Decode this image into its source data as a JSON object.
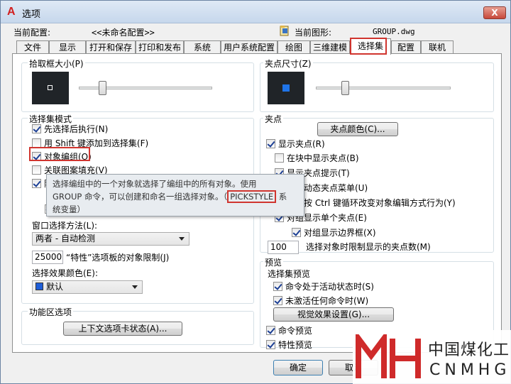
{
  "window": {
    "title": "选项",
    "app_icon": "A",
    "close_label": "X"
  },
  "header": {
    "profile_label": "当前配置:",
    "profile_value": "<<未命名配置>>",
    "drawing_label": "当前图形:",
    "drawing_value": "GROUP.dwg"
  },
  "tabs": [
    "文件",
    "显示",
    "打开和保存",
    "打印和发布",
    "系统",
    "用户系统配置",
    "绘图",
    "三维建模",
    "选择集",
    "配置",
    "联机"
  ],
  "active_tab": "选择集",
  "left": {
    "pickbox": {
      "title": "拾取框大小(P)"
    },
    "selection_modes": {
      "title": "选择集模式",
      "items": [
        {
          "label": "先选择后执行(N)",
          "checked": true
        },
        {
          "label": "用 Shift 键添加到选择集(F)",
          "checked": false
        },
        {
          "label": "对象编组(O)",
          "checked": true
        },
        {
          "label": "关联图案填充(V)",
          "checked": false
        },
        {
          "label": "隐",
          "checked": true
        },
        {
          "label": "",
          "checked": true
        }
      ]
    },
    "window_method": {
      "label": "窗口选择方法(L):",
      "value": "两者 - 自动检测"
    },
    "limit": {
      "value": "25000",
      "label": "“特性”选项板的对象限制(J)"
    },
    "effect_color": {
      "label": "选择效果颜色(E):",
      "value": "默认"
    },
    "ribbon": {
      "title": "功能区选项",
      "button": "上下文选项卡状态(A)..."
    }
  },
  "right": {
    "gripsize": {
      "title": "夹点尺寸(Z)"
    },
    "grips": {
      "title": "夹点",
      "color_button": "夹点颜色(C)...",
      "items": [
        {
          "label": "显示夹点(R)",
          "checked": true
        },
        {
          "label": "在块中显示夹点(B)",
          "checked": false
        },
        {
          "label": "显示夹点提示(T)",
          "checked": true
        },
        {
          "label": "显示动态夹点菜单(U)",
          "checked": true
        },
        {
          "label": "允许按 Ctrl 键循环改变对象编辑方式行为(Y)",
          "checked": true
        },
        {
          "label": "对组显示单个夹点(E)",
          "checked": true
        },
        {
          "label": "对组显示边界框(X)",
          "checked": true
        }
      ],
      "limit_value": "100",
      "limit_label": "选择对象时限制显示的夹点数(M)"
    },
    "preview": {
      "title": "预览",
      "subtitle": "选择集预览",
      "items": [
        {
          "label": "命令处于活动状态时(S)",
          "checked": true
        },
        {
          "label": "未激活任何命令时(W)",
          "checked": true
        }
      ],
      "effects_button": "视觉效果设置(G)...",
      "cmd_preview": {
        "label": "命令预览",
        "checked": true
      },
      "prop_preview": {
        "label": "特性预览",
        "checked": true
      }
    }
  },
  "tooltip": {
    "line1": "选择编组中的一个对象就选择了编组中的所有对象。使用",
    "line2a": "GROUP 命令，可以创建和命名一组选择对象。（",
    "highlight": "PICKSTYLE",
    "line2b": " 系",
    "line3": "统变量）"
  },
  "footer": {
    "ok": "确定",
    "cancel": "取消"
  },
  "logo": {
    "cn": "中国煤化工",
    "en": "CNMHG"
  },
  "colors": {
    "accent_red": "#d0352f",
    "grip_blue": "#1f74e8",
    "preview_dark": "#202428"
  }
}
